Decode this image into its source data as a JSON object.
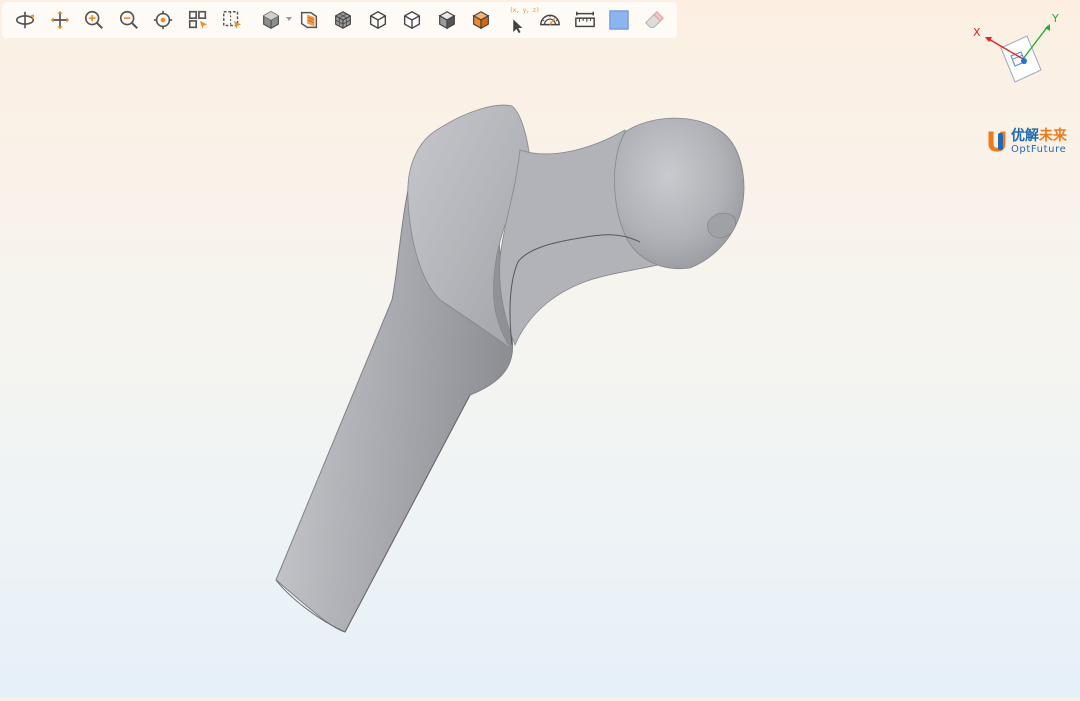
{
  "toolbar": {
    "tools": [
      {
        "name": "rotate",
        "icon": "rotate-icon"
      },
      {
        "name": "pan",
        "icon": "pan-icon"
      },
      {
        "name": "zoom-in",
        "icon": "zoom-in-icon"
      },
      {
        "name": "zoom-out",
        "icon": "zoom-out-icon"
      },
      {
        "name": "fit-center",
        "icon": "target-icon"
      },
      {
        "name": "select-parts",
        "icon": "select-grid-icon"
      },
      {
        "name": "box-select",
        "icon": "box-select-icon"
      },
      {
        "name": "view-cube",
        "icon": "cube-dropdown-icon"
      },
      {
        "name": "section",
        "icon": "section-plane-icon"
      },
      {
        "name": "mesh",
        "icon": "mesh-cube-icon"
      },
      {
        "name": "wireframe",
        "icon": "wire-cube-icon"
      },
      {
        "name": "hidden-line",
        "icon": "hidden-line-cube-icon"
      },
      {
        "name": "shaded",
        "icon": "shaded-cube-icon"
      },
      {
        "name": "shaded-edges",
        "icon": "orange-cube-icon"
      },
      {
        "name": "pick-point",
        "icon": "pick-point-icon"
      },
      {
        "name": "angle-measure",
        "icon": "protractor-icon"
      },
      {
        "name": "distance-measure",
        "icon": "ruler-icon"
      },
      {
        "name": "background-color",
        "icon": "color-swatch-icon"
      },
      {
        "name": "clear",
        "icon": "eraser-icon"
      }
    ],
    "coord_label": "(x, y, z)"
  },
  "gizmo": {
    "x_label": "X",
    "y_label": "Y",
    "x_color": "#e02020",
    "y_color": "#22b033",
    "z_color": "#2b6fd6"
  },
  "logo": {
    "cn_part1": "优解",
    "cn_part2": "未来",
    "en": "OptFuture",
    "blue": "#1f6ab3",
    "orange": "#f07a1a"
  },
  "colors": {
    "accent": "#f08a2c",
    "icon_dark": "#555555",
    "model_fill": "#a9abb1"
  }
}
